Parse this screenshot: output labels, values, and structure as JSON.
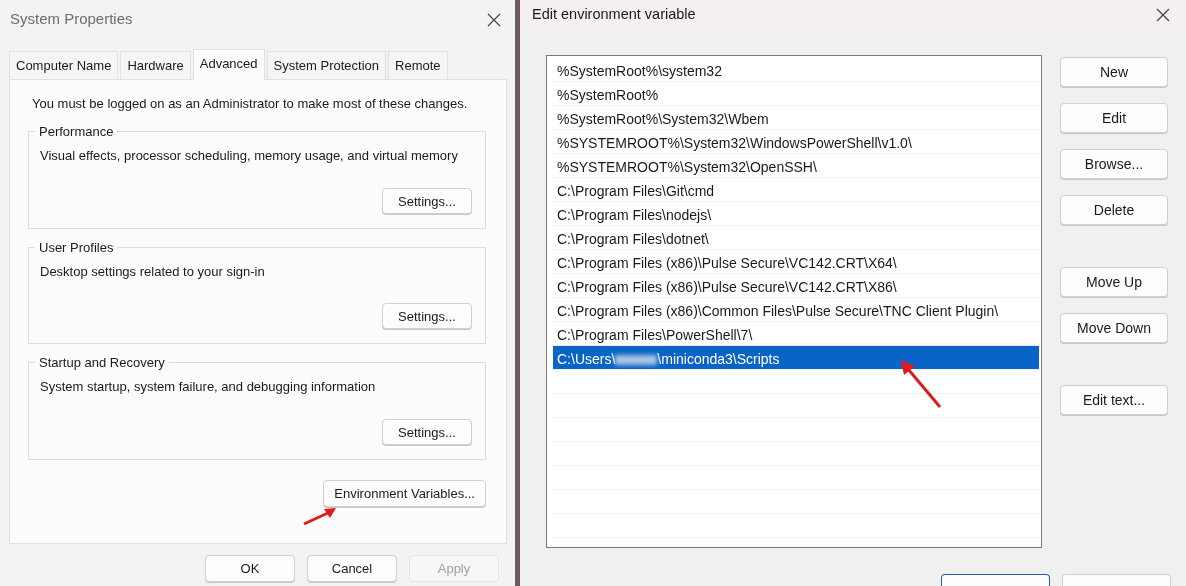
{
  "system_properties": {
    "title": "System Properties",
    "tabs": [
      {
        "label": "Computer Name",
        "selected": false
      },
      {
        "label": "Hardware",
        "selected": false
      },
      {
        "label": "Advanced",
        "selected": true
      },
      {
        "label": "System Protection",
        "selected": false
      },
      {
        "label": "Remote",
        "selected": false
      }
    ],
    "notice": "You must be logged on as an Administrator to make most of these changes.",
    "groups": [
      {
        "title": "Performance",
        "description": "Visual effects, processor scheduling, memory usage, and virtual memory",
        "button": "Settings..."
      },
      {
        "title": "User Profiles",
        "description": "Desktop settings related to your sign-in",
        "button": "Settings..."
      },
      {
        "title": "Startup and Recovery",
        "description": "System startup, system failure, and debugging information",
        "button": "Settings..."
      }
    ],
    "environment_button": "Environment Variables...",
    "buttons": [
      {
        "label": "OK",
        "disabled": false
      },
      {
        "label": "Cancel",
        "disabled": false
      },
      {
        "label": "Apply",
        "disabled": true
      }
    ]
  },
  "edit_variable": {
    "title": "Edit environment variable",
    "entries": [
      {
        "text": "%SystemRoot%\\system32",
        "selected": false
      },
      {
        "text": "%SystemRoot%",
        "selected": false
      },
      {
        "text": "%SystemRoot%\\System32\\Wbem",
        "selected": false
      },
      {
        "text": "%SYSTEMROOT%\\System32\\WindowsPowerShell\\v1.0\\",
        "selected": false
      },
      {
        "text": "%SYSTEMROOT%\\System32\\OpenSSH\\",
        "selected": false
      },
      {
        "text": "C:\\Program Files\\Git\\cmd",
        "selected": false
      },
      {
        "text": "C:\\Program Files\\nodejs\\",
        "selected": false
      },
      {
        "text": "C:\\Program Files\\dotnet\\",
        "selected": false
      },
      {
        "text": "C:\\Program Files (x86)\\Pulse Secure\\VC142.CRT\\X64\\",
        "selected": false
      },
      {
        "text": "C:\\Program Files (x86)\\Pulse Secure\\VC142.CRT\\X86\\",
        "selected": false
      },
      {
        "text": "C:\\Program Files (x86)\\Common Files\\Pulse Secure\\TNC Client Plugin\\",
        "selected": false
      },
      {
        "text": "C:\\Program Files\\PowerShell\\7\\",
        "selected": false
      },
      {
        "text": "C:\\Users\\",
        "redacted_part": true,
        "text_after": "\\miniconda3\\Scripts",
        "selected": true
      }
    ],
    "side_button_groups": [
      [
        "New",
        "Edit",
        "Browse...",
        "Delete"
      ],
      [
        "Move Up",
        "Move Down"
      ],
      [
        "Edit text..."
      ]
    ]
  }
}
